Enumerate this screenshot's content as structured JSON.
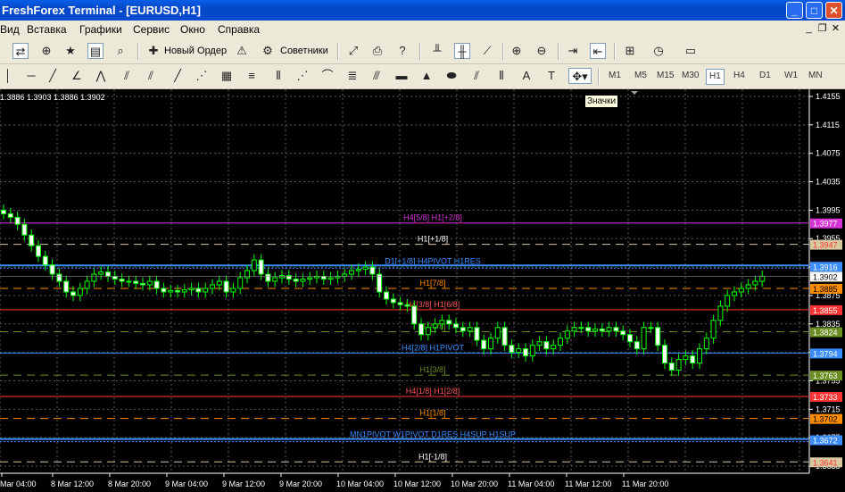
{
  "window": {
    "title": "FreshForex Terminal - [EURUSD,H1]"
  },
  "menu": [
    "Вид",
    "Вставка",
    "Графики",
    "Сервис",
    "Окно",
    "Справка"
  ],
  "toolbar": {
    "new_order": "Новый Ордер",
    "advisors": "Советники"
  },
  "timeframes": [
    "M1",
    "M5",
    "M15",
    "M30",
    "H1",
    "H4",
    "D1",
    "W1",
    "MN"
  ],
  "active_timeframe": "H1",
  "tooltip": "Значки",
  "chart": {
    "ohlc": "1.3886 1.3903 1.3886 1.3902",
    "price_ticks": [
      "1.4155",
      "1.4115",
      "1.4075",
      "1.4035",
      "1.3995",
      "1.3955",
      "1.3915",
      "1.3875",
      "1.3835",
      "1.3795",
      "1.3755",
      "1.3715",
      "1.3675",
      "1.3635"
    ],
    "time_labels": [
      "Mar 04:00",
      "8 Mar 12:00",
      "8 Mar 20:00",
      "9 Mar 04:00",
      "9 Mar 12:00",
      "9 Mar 20:00",
      "10 Mar 04:00",
      "10 Mar 12:00",
      "10 Mar 20:00",
      "11 Mar 04:00",
      "11 Mar 12:00",
      "11 Mar 20:00"
    ],
    "levels": [
      {
        "label": "H4[5/8] H1[+2/8]",
        "price": "1.3977",
        "color": "#d633d6",
        "style": "solid",
        "label_color": "#d633d6",
        "badge_text": "#ffffff"
      },
      {
        "label": "H1[+1/8]",
        "price": "1.3947",
        "color": "#d8c8a0",
        "style": "dashed",
        "label_color": "#ffffff",
        "badge_text": "#ff3333"
      },
      {
        "label": "D1[+1/8] H4PIVOT H1RES",
        "price": "1.3916",
        "color": "#3a8cff",
        "style": "thick",
        "label_color": "#3a8cff",
        "badge_text": "#ffffff"
      },
      {
        "label": "",
        "price": "1.3902",
        "color": "#c0c0c0",
        "style": "none",
        "label_color": "#ffffff",
        "badge_text": "#000000",
        "badge_bg": "#ffffff"
      },
      {
        "label": "H1[7/8]",
        "price": "1.3885",
        "color": "#ff8c00",
        "style": "dashed",
        "label_color": "#ff8c00",
        "badge_text": "#000000"
      },
      {
        "label": "H4[3/8] H1[6/8]",
        "price": "1.3855",
        "color": "#ff3333",
        "style": "solid",
        "label_color": "#ff5555",
        "badge_text": "#ffffff"
      },
      {
        "label": "H1[5/8]",
        "price": "1.3824",
        "color": "#6b8e23",
        "style": "dashed",
        "label_color": "#6b8e23",
        "badge_text": "#ffffff"
      },
      {
        "label": "H4[2/8] H1PIVOT",
        "price": "1.3794",
        "color": "#3a8cff",
        "style": "solid",
        "label_color": "#3a8cff",
        "badge_text": "#ffffff"
      },
      {
        "label": "H1[3/8]",
        "price": "1.3763",
        "color": "#6b8e23",
        "style": "dashed",
        "label_color": "#6b8e23",
        "badge_text": "#ffffff"
      },
      {
        "label": "H4[1/8] H1[2/8]",
        "price": "1.3733",
        "color": "#ff3333",
        "style": "solid",
        "label_color": "#ff5555",
        "badge_text": "#ffffff"
      },
      {
        "label": "H1[1/8]",
        "price": "1.3702",
        "color": "#ff8c00",
        "style": "dashed",
        "label_color": "#ff8c00",
        "badge_text": "#000000"
      },
      {
        "label": "MN1PIVOT W1PIVOT D1RES H4SUP H1SUP",
        "price": "1.3672",
        "color": "#3a8cff",
        "style": "thick",
        "label_color": "#3a8cff",
        "badge_text": "#ffffff"
      },
      {
        "label": "H1[-1/8]",
        "price": "1.3641",
        "color": "#d8c8a0",
        "style": "dashed",
        "label_color": "#ffffff",
        "badge_text": "#ff3333"
      }
    ]
  },
  "chart_data": {
    "type": "candlestick",
    "symbol": "EURUSD",
    "timeframe": "H1",
    "ylim": [
      1.3625,
      1.4165
    ],
    "grid": true,
    "closes": [
      1.399,
      1.3985,
      1.3975,
      1.396,
      1.3945,
      1.393,
      1.3918,
      1.3905,
      1.3895,
      1.388,
      1.3875,
      1.3885,
      1.3895,
      1.3905,
      1.3908,
      1.3902,
      1.3898,
      1.3895,
      1.3895,
      1.3892,
      1.389,
      1.3895,
      1.3885,
      1.388,
      1.3882,
      1.388,
      1.3883,
      1.3885,
      1.388,
      1.3885,
      1.389,
      1.3895,
      1.388,
      1.3885,
      1.39,
      1.391,
      1.3925,
      1.3905,
      1.3895,
      1.39,
      1.3903,
      1.3898,
      1.3895,
      1.3898,
      1.39,
      1.3902,
      1.3898,
      1.39,
      1.3902,
      1.3905,
      1.391,
      1.3912,
      1.3915,
      1.3905,
      1.388,
      1.387,
      1.3865,
      1.3862,
      1.386,
      1.3835,
      1.382,
      1.383,
      1.3835,
      1.384,
      1.3835,
      1.383,
      1.3825,
      1.383,
      1.3812,
      1.38,
      1.3815,
      1.383,
      1.3805,
      1.3795,
      1.38,
      1.379,
      1.3805,
      1.381,
      1.38,
      1.3805,
      1.3815,
      1.3825,
      1.383,
      1.383,
      1.3825,
      1.3828,
      1.3825,
      1.383,
      1.3825,
      1.382,
      1.381,
      1.38,
      1.383,
      1.383,
      1.3805,
      1.378,
      1.377,
      1.3785,
      1.379,
      1.378,
      1.38,
      1.3815,
      1.384,
      1.386,
      1.3875,
      1.388,
      1.3885,
      1.389,
      1.3895,
      1.3902
    ]
  }
}
